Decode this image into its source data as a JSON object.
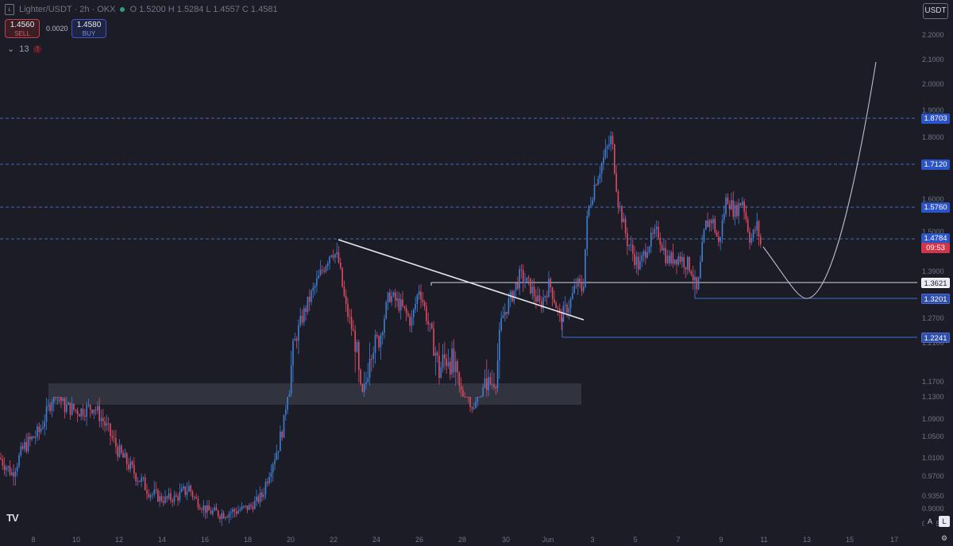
{
  "header": {
    "symbol": "Lighter/USDT",
    "interval": "2h",
    "exchange": "OKX",
    "title_text": "Lighter/USDT · 2h · OKX",
    "ohlc_text": "O 1.5200  H 1.5284  L 1.4557  C 1.4581"
  },
  "trade_panel": {
    "sell_price": "1.4560",
    "sell_label": "SELL",
    "spread": "0.0020",
    "buy_price": "1.4580",
    "buy_label": "BUY"
  },
  "indicators": {
    "collapse_glyph": "⌄",
    "count": "13",
    "alert_glyph": "!"
  },
  "currency": "USDT",
  "colors": {
    "background": "#1b1c26",
    "candle_up": "#3f7fd6",
    "candle_down": "#e04b63",
    "dashed_level": "#4f78c9",
    "grid_text": "#6e7484"
  },
  "price_axis": {
    "ticks": [
      "2.2000",
      "2.1000",
      "2.0000",
      "1.9000",
      "1.8000",
      "1.7000",
      "1.6000",
      "1.5000",
      "1.3900",
      "1.2700",
      "1.2100",
      "1.1700",
      "1.1300",
      "1.0900",
      "1.0500",
      "1.0100",
      "0.9700",
      "0.9350",
      "0.9000",
      "0.8650"
    ]
  },
  "time_axis": {
    "labels": [
      "8",
      "10",
      "12",
      "14",
      "16",
      "18",
      "20",
      "22",
      "24",
      "26",
      "28",
      "30",
      "Jun",
      "3",
      "5",
      "7",
      "9",
      "11",
      "13",
      "15",
      "17"
    ]
  },
  "levels": {
    "dashed": [
      {
        "label": "1.8703",
        "value": 1.8703
      },
      {
        "label": "1.7120",
        "value": 1.712
      },
      {
        "label": "1.5760",
        "value": 1.576
      },
      {
        "label": "1.4784",
        "value": 1.4784
      }
    ],
    "solid": [
      {
        "label": "1.3621",
        "value": 1.3621
      },
      {
        "label": "1.3201",
        "value": 1.3201
      },
      {
        "label": "1.2241",
        "value": 1.2241
      }
    ],
    "countdown": "09:53"
  },
  "chart_data": {
    "type": "candlestick",
    "timeframe": "2h",
    "x_range": [
      "May 7",
      "Jun 17"
    ],
    "ylim": [
      0.84,
      2.25
    ],
    "drawn_zone": {
      "from": 1.075,
      "to": 1.12
    },
    "trendline": {
      "from": 1.475,
      "to": 1.27
    },
    "projection": {
      "from": 1.47,
      "low": 1.31,
      "to": 2.09
    },
    "current_price": 1.4581
  },
  "footer": {
    "tv_logo": "TV",
    "auto_label": "A",
    "log_label": "L",
    "settings_glyph": "⚙"
  }
}
